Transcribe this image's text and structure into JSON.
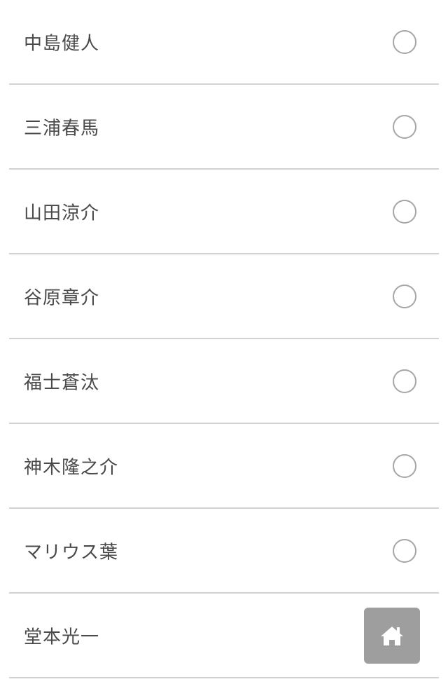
{
  "list": {
    "items": [
      {
        "label": "中島健人",
        "selected": false
      },
      {
        "label": "三浦春馬",
        "selected": false
      },
      {
        "label": "山田涼介",
        "selected": false
      },
      {
        "label": "谷原章介",
        "selected": false
      },
      {
        "label": "福士蒼汰",
        "selected": false
      },
      {
        "label": "神木隆之介",
        "selected": false
      },
      {
        "label": "マリウス葉",
        "selected": false
      },
      {
        "label": "堂本光一",
        "selected": false
      }
    ]
  },
  "home_button": {
    "icon": "home-icon",
    "background": "#9e9e9e",
    "icon_color": "#ffffff"
  },
  "colors": {
    "text": "#4a4a4a",
    "divider": "#d2d2d2",
    "radio_border": "#a6a6a6"
  }
}
